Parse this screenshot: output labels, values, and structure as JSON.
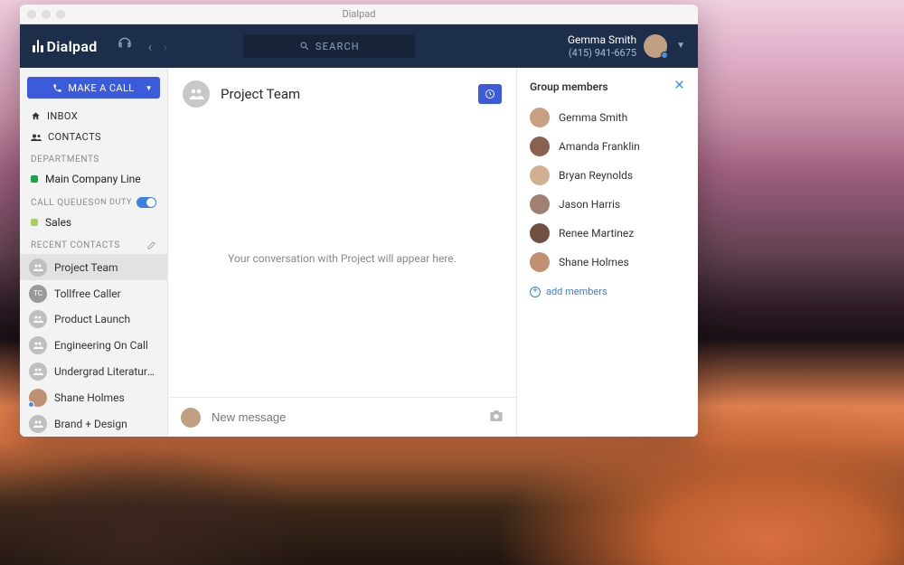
{
  "window": {
    "title": "Dialpad"
  },
  "brand": "Dialpad",
  "search": {
    "placeholder": "SEARCH"
  },
  "user": {
    "name": "Gemma Smith",
    "phone": "(415) 941-6675"
  },
  "make_call_label": "MAKE A CALL",
  "nav": {
    "inbox": "INBOX",
    "contacts": "CONTACTS"
  },
  "sections": {
    "departments": "DEPARTMENTS",
    "call_queues": "CALL QUEUES",
    "on_duty": "ON DUTY",
    "recent_contacts": "RECENT CONTACTS"
  },
  "departments": [
    {
      "label": "Main Company Line",
      "color": "#18a24b"
    }
  ],
  "queues": [
    {
      "label": "Sales",
      "color": "#a8d05a"
    }
  ],
  "recent": [
    {
      "label": "Project Team",
      "type": "group",
      "active": true
    },
    {
      "label": "Tollfree Caller",
      "type": "initials",
      "initials": "TC"
    },
    {
      "label": "Product Launch",
      "type": "group"
    },
    {
      "label": "Engineering On Call",
      "type": "group"
    },
    {
      "label": "Undergrad Literature Pr...",
      "type": "group"
    },
    {
      "label": "Shane Holmes",
      "type": "person"
    },
    {
      "label": "Brand + Design",
      "type": "group"
    }
  ],
  "conversation": {
    "title": "Project Team",
    "empty_message": "Your conversation with Project will appear here.",
    "composer_placeholder": "New message"
  },
  "members_panel": {
    "title": "Group members",
    "add_label": "add members",
    "members": [
      {
        "name": "Gemma Smith"
      },
      {
        "name": "Amanda Franklin"
      },
      {
        "name": "Bryan Reynolds"
      },
      {
        "name": "Jason Harris"
      },
      {
        "name": "Renee Martinez"
      },
      {
        "name": "Shane Holmes"
      }
    ]
  }
}
